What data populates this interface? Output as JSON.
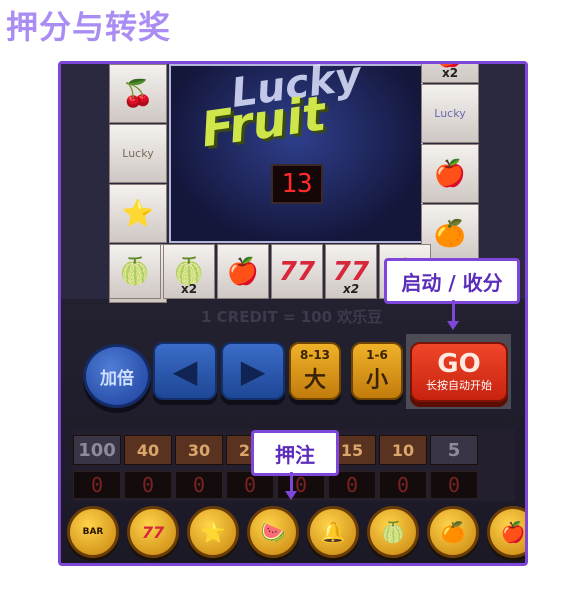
{
  "page_title": "押分与转奖",
  "game_title": "Fruit",
  "game_title_top": "Lucky",
  "center_led": "13",
  "credit_text": "1 CREDIT = 100 欢乐豆",
  "reels": {
    "left": [
      {
        "symbol": "🍒",
        "mult": ""
      },
      {
        "symbol": "Lucky",
        "mult": ""
      },
      {
        "symbol": "⭐",
        "mult": ""
      },
      {
        "symbol": "⭐",
        "mult": "x2"
      }
    ],
    "right": [
      {
        "symbol": "🍎",
        "mult": "x2"
      },
      {
        "symbol": "Lucky",
        "mult": ""
      },
      {
        "symbol": "🍎",
        "mult": ""
      },
      {
        "symbol": "🍊",
        "mult": ""
      },
      {
        "symbol": "🍊",
        "mult": "x2"
      }
    ],
    "bottom": [
      {
        "symbol": "🍈",
        "mult": ""
      },
      {
        "symbol": "🍈",
        "mult": "x2"
      },
      {
        "symbol": "🍎",
        "mult": ""
      },
      {
        "symbol": "77",
        "mult": ""
      },
      {
        "symbol": "77",
        "mult": "x2"
      },
      {
        "symbol": "🔔",
        "mult": ""
      }
    ]
  },
  "buttons": {
    "double": "加倍",
    "left_arrow": "◀",
    "right_arrow": "▶",
    "big_range": "8-13",
    "big_label": "大",
    "small_range": "1-6",
    "small_label": "小",
    "go_label": "GO",
    "go_sub": "长按自动开始"
  },
  "bet_panel": {
    "left_value": "100",
    "payouts": [
      "40",
      "30",
      "20",
      "20",
      "15",
      "10"
    ],
    "right_value": "5",
    "digits": [
      "0",
      "0",
      "0",
      "0",
      "0",
      "0",
      "0",
      "0"
    ]
  },
  "bet_icons": [
    {
      "icon": "bar-icon",
      "glyph": "BAR"
    },
    {
      "icon": "seven-icon",
      "glyph": "77"
    },
    {
      "icon": "star-icon",
      "glyph": "⭐"
    },
    {
      "icon": "watermelon-icon",
      "glyph": "🍉"
    },
    {
      "icon": "bell-icon",
      "glyph": "🔔"
    },
    {
      "icon": "lime-icon",
      "glyph": "🍈"
    },
    {
      "icon": "orange-icon",
      "glyph": "🍊"
    },
    {
      "icon": "apple-icon",
      "glyph": "🍎"
    }
  ],
  "callouts": {
    "start_collect": "启动 / 收分",
    "bet": "押注"
  }
}
